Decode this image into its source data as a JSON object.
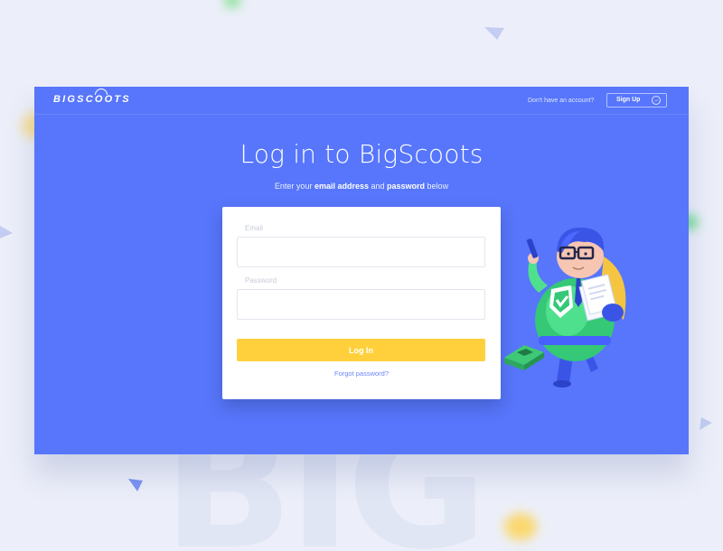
{
  "header": {
    "logo_text": "BIGSCOOTS",
    "account_prompt": "Don't have an account?",
    "signup_label": "Sign Up",
    "signup_icon": "sign-in-icon"
  },
  "main": {
    "title": "Log in to BigScoots",
    "subtitle": {
      "prefix": "Enter your ",
      "email_bold": "email address",
      "middle": " and ",
      "password_bold": "password",
      "suffix": " below"
    }
  },
  "form": {
    "email_label": "Email",
    "email_value": "",
    "password_label": "Password",
    "password_value": "",
    "submit_label": "Log In",
    "forgot_label": "Forgot password?"
  },
  "background": {
    "watermark_text": "BIG"
  },
  "colors": {
    "panel": "#5776fb",
    "button": "#ffd03b",
    "link": "#6b86ff",
    "page_bg": "#eceff9"
  }
}
